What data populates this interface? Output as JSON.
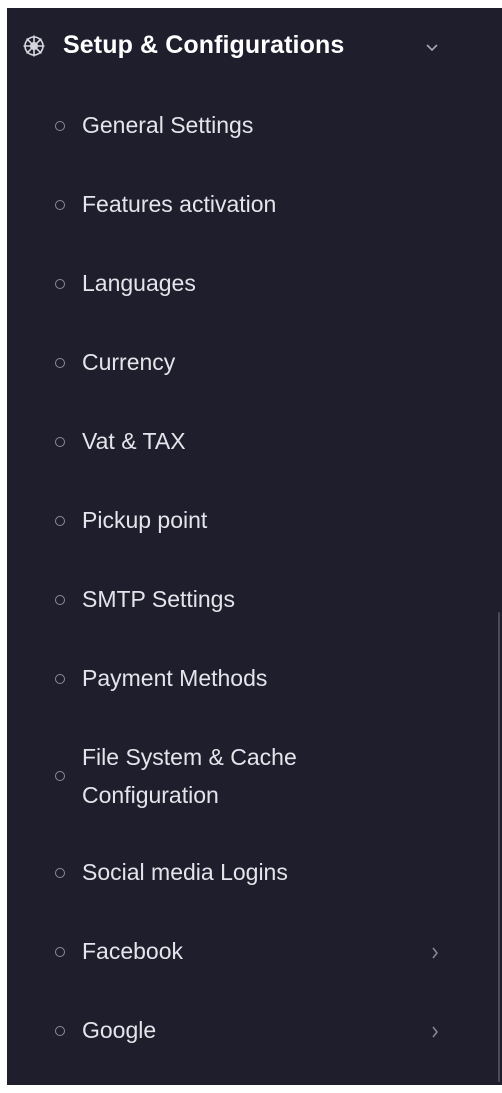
{
  "section": {
    "title": "Setup & Configurations",
    "icon": "gear-icon",
    "expanded": true
  },
  "items": [
    {
      "label": "General Settings",
      "has_submenu": false
    },
    {
      "label": "Features activation",
      "has_submenu": false
    },
    {
      "label": "Languages",
      "has_submenu": false
    },
    {
      "label": "Currency",
      "has_submenu": false
    },
    {
      "label": "Vat & TAX",
      "has_submenu": false
    },
    {
      "label": "Pickup point",
      "has_submenu": false
    },
    {
      "label": "SMTP Settings",
      "has_submenu": false
    },
    {
      "label": "Payment Methods",
      "has_submenu": false
    },
    {
      "label": "File System & Cache Configuration",
      "has_submenu": false
    },
    {
      "label": "Social media Logins",
      "has_submenu": false
    },
    {
      "label": "Facebook",
      "has_submenu": true
    },
    {
      "label": "Google",
      "has_submenu": true
    }
  ],
  "colors": {
    "sidebar_bg": "#1e1e2d",
    "text": "#e4e4ea",
    "bullet": "#8b8b98"
  }
}
